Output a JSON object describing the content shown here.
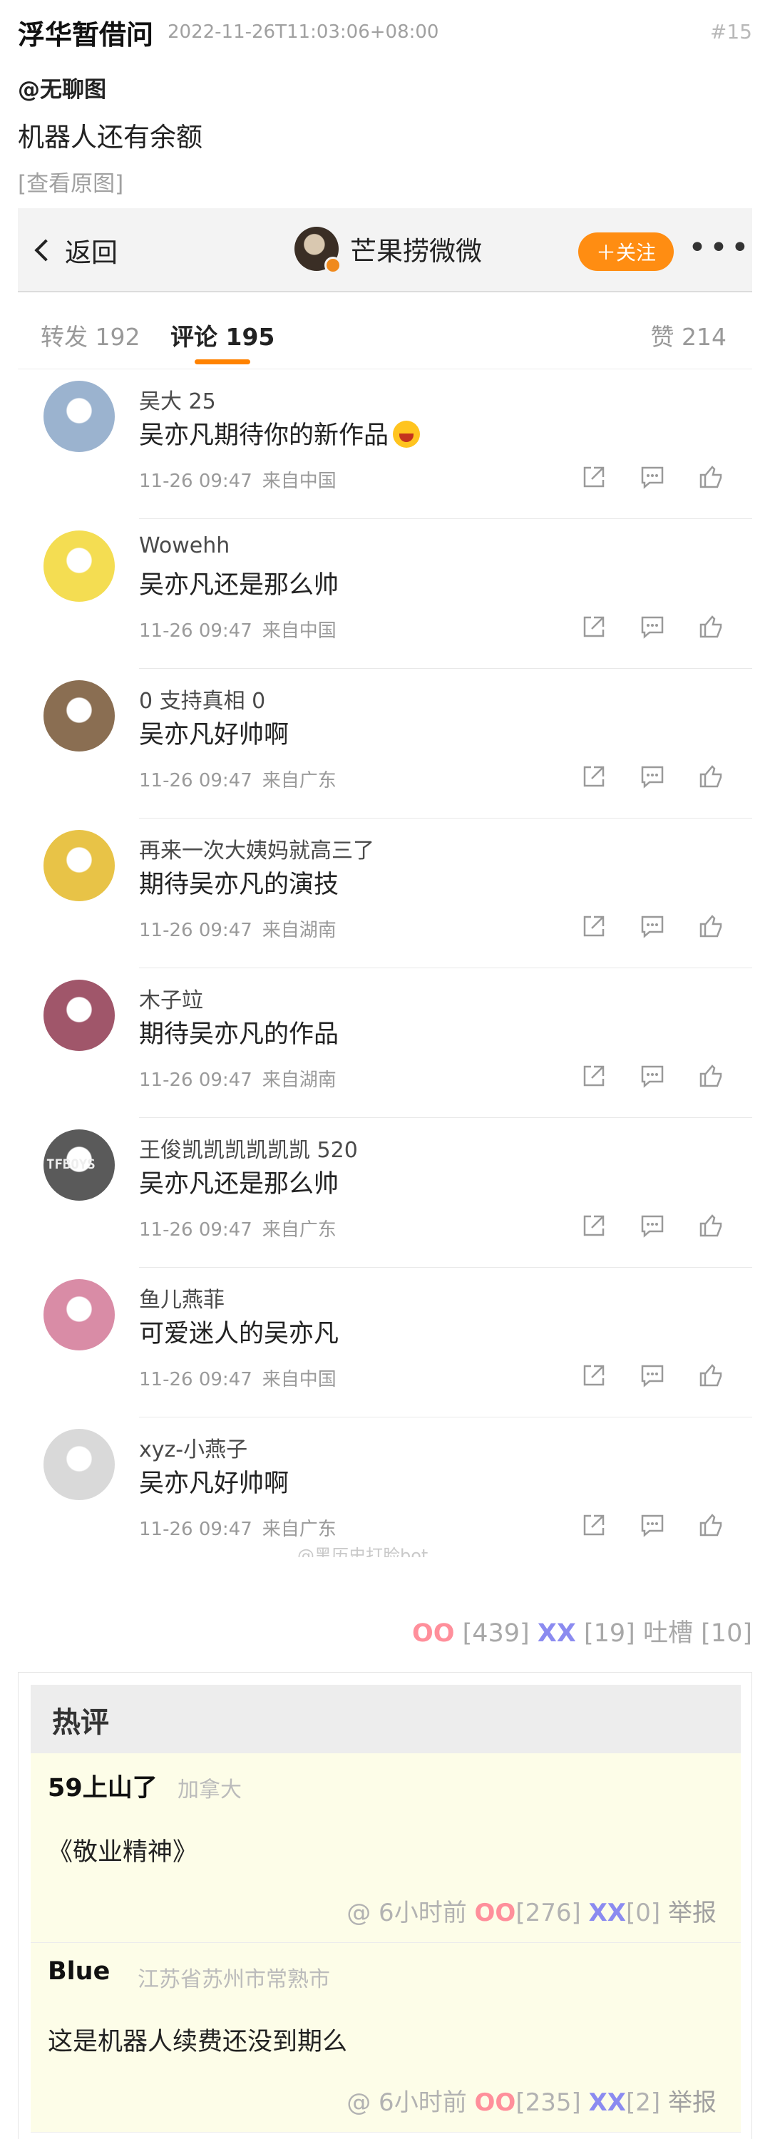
{
  "post": {
    "author": "浮华暂借问",
    "timestamp": "2022-11-26T11:03:06+08:00",
    "number": "#15",
    "mention": "@无聊图",
    "text": "机器人还有余额",
    "view_original": "[查看原图]"
  },
  "embedded": {
    "nav": {
      "back_label": "返回",
      "user_name": "芒果捞微微",
      "follow_label": "＋关注",
      "more_label": "•••"
    },
    "tabs": {
      "repost": "转发 192",
      "comment": "评论 195",
      "like": "赞 214"
    },
    "comments": [
      {
        "user": "吴大 25",
        "text": "吴亦凡期待你的新作品",
        "time": "11-26 09:47",
        "location": "来自中国",
        "avatar_color": "#9bb3cf"
      },
      {
        "user": "Wowehh",
        "text": "吴亦凡还是那么帅",
        "time": "11-26 09:47",
        "location": "来自中国",
        "avatar_color": "#f4dd52"
      },
      {
        "user": "0 支持真相 0",
        "text": "吴亦凡好帅啊",
        "time": "11-26 09:47",
        "location": "来自广东",
        "avatar_color": "#8a6e52"
      },
      {
        "user": "再来一次大姨妈就高三了",
        "text": "期待吴亦凡的演技",
        "time": "11-26 09:47",
        "location": "来自湖南",
        "avatar_color": "#e8c347"
      },
      {
        "user": "木子竝",
        "text": "期待吴亦凡的作品",
        "time": "11-26 09:47",
        "location": "来自湖南",
        "avatar_color": "#a0566a"
      },
      {
        "user": "王俊凯凯凯凯凯凯 520",
        "text": "吴亦凡还是那么帅",
        "time": "11-26 09:47",
        "location": "来自广东",
        "avatar_color": "#5a5a5a",
        "avatar_text": "TFBOYS"
      },
      {
        "user": "鱼儿燕菲",
        "text": "可爱迷人的吴亦凡",
        "time": "11-26 09:47",
        "location": "来自中国",
        "avatar_color": "#d98ca6"
      },
      {
        "user": "xyz-小燕子",
        "text": "吴亦凡好帅啊",
        "time": "11-26 09:47",
        "location": "来自广东",
        "avatar_color": "#d9d9d9"
      }
    ],
    "watermark": "@黑历史打脸bot"
  },
  "votes": {
    "oo_label": "OO",
    "oo_count": "[439]",
    "xx_label": "XX",
    "xx_count": "[19]",
    "tucao_label": "吐槽",
    "tucao_count": "[10]"
  },
  "hot": {
    "title": "热评",
    "comments": [
      {
        "author": "59上山了",
        "location": "加拿大",
        "text": "《敬业精神》",
        "time": "@ 6小时前",
        "oo": "OO",
        "oo_count": "[276]",
        "xx": "XX",
        "xx_count": "[0]",
        "report": "举报"
      },
      {
        "author": "Blue",
        "location": "江苏省苏州市常熟市",
        "text": "这是机器人续费还没到期么",
        "time": "@ 6小时前",
        "oo": "OO",
        "oo_count": "[235]",
        "xx": "XX",
        "xx_count": "[2]",
        "report": "举报"
      }
    ]
  }
}
